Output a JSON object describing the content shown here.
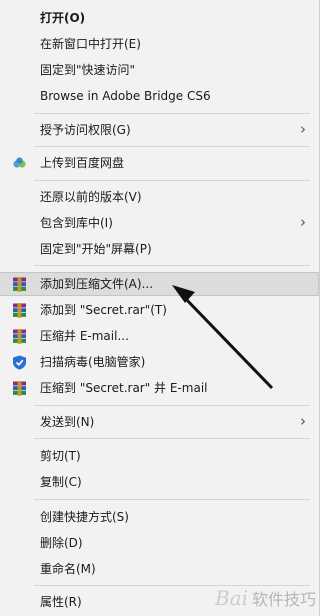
{
  "menu": {
    "items": [
      {
        "id": "open",
        "label": "打开(O)",
        "bold": true
      },
      {
        "id": "open-new-window",
        "label": "在新窗口中打开(E)"
      },
      {
        "id": "pin-quick-access",
        "label": "固定到\"快速访问\""
      },
      {
        "id": "browse-bridge",
        "label": "Browse in Adobe Bridge CS6"
      },
      {
        "id": "grant-access",
        "label": "授予访问权限(G)",
        "submenu": true
      },
      {
        "id": "upload-baidu",
        "label": "上传到百度网盘",
        "icon": "cloud-icon"
      },
      {
        "id": "restore-versions",
        "label": "还原以前的版本(V)"
      },
      {
        "id": "include-library",
        "label": "包含到库中(I)",
        "submenu": true
      },
      {
        "id": "pin-start",
        "label": "固定到\"开始\"屏幕(P)"
      },
      {
        "id": "add-archive",
        "label": "添加到压缩文件(A)...",
        "icon": "winrar-icon"
      },
      {
        "id": "add-secret-rar",
        "label": "添加到 \"Secret.rar\"(T)",
        "icon": "winrar-icon"
      },
      {
        "id": "compress-email",
        "label": "压缩并 E-mail...",
        "icon": "winrar-icon"
      },
      {
        "id": "scan-virus",
        "label": "扫描病毒(电脑管家)",
        "icon": "shield-icon"
      },
      {
        "id": "compress-secret-email",
        "label": "压缩到 \"Secret.rar\" 并 E-mail",
        "icon": "winrar-icon"
      },
      {
        "id": "send-to",
        "label": "发送到(N)",
        "submenu": true
      },
      {
        "id": "cut",
        "label": "剪切(T)"
      },
      {
        "id": "copy",
        "label": "复制(C)"
      },
      {
        "id": "create-shortcut",
        "label": "创建快捷方式(S)"
      },
      {
        "id": "delete",
        "label": "删除(D)"
      },
      {
        "id": "rename",
        "label": "重命名(M)"
      },
      {
        "id": "properties",
        "label": "属性(R)"
      }
    ],
    "highlighted": "add-archive",
    "submenu_glyph": "›"
  },
  "watermark": {
    "brand": "Bai",
    "text": "软件技巧"
  },
  "colors": {
    "menu_bg": "#f2f2f2",
    "highlight_bg": "#dcdcdc",
    "separator": "#d6d6d6",
    "shield": "#2b6fd6"
  }
}
